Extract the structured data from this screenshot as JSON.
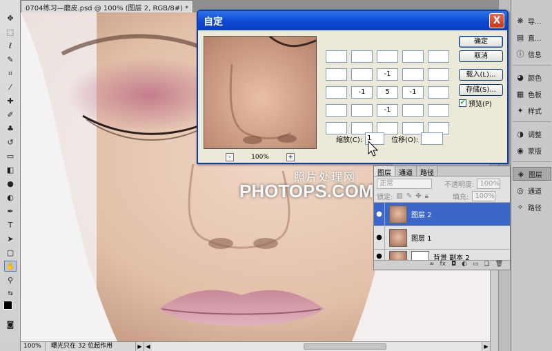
{
  "document": {
    "tab_title": "0704练习—磨皮.psd @ 100% (图层 2, RGB/8#) *",
    "close_glyph": "×"
  },
  "status": {
    "zoom": "100%",
    "message": "曝光只在 32 位起作用"
  },
  "right_dock": {
    "items": [
      {
        "label": "导...",
        "icon": "navigator-icon"
      },
      {
        "label": "直...",
        "icon": "histogram-icon"
      },
      {
        "label": "信息",
        "icon": "info-icon"
      },
      {
        "label": "颜色",
        "icon": "color-icon"
      },
      {
        "label": "色板",
        "icon": "swatches-icon"
      },
      {
        "label": "样式",
        "icon": "styles-icon"
      },
      {
        "label": "调整",
        "icon": "adjustments-icon"
      },
      {
        "label": "蒙版",
        "icon": "masks-icon"
      },
      {
        "label": "图层",
        "icon": "layers-icon"
      },
      {
        "label": "通道",
        "icon": "channels-icon"
      },
      {
        "label": "路径",
        "icon": "paths-icon"
      }
    ]
  },
  "dialog": {
    "title": "自定",
    "close": "X",
    "zoom_minus": "-",
    "zoom_value": "100%",
    "zoom_plus": "+",
    "kernel": [
      [
        "",
        "",
        "",
        "",
        ""
      ],
      [
        "",
        "",
        "-1",
        "",
        ""
      ],
      [
        "",
        "-1",
        "5",
        "-1",
        ""
      ],
      [
        "",
        "",
        "-1",
        "",
        ""
      ],
      [
        "",
        "",
        "",
        "",
        ""
      ]
    ],
    "scale_label": "缩放(C):",
    "scale_value": "1",
    "offset_label": "位移(O):",
    "offset_value": "",
    "buttons": {
      "ok": "确定",
      "cancel": "取消",
      "load": "载入(L)...",
      "save": "存储(S)..."
    },
    "preview_label": "预览(P)",
    "preview_checked": "✔"
  },
  "layers_panel": {
    "tabs": [
      "图层",
      "通道",
      "路径"
    ],
    "blend_mode": "正常",
    "opacity_label": "不透明度:",
    "opacity_value": "100%",
    "lock_label": "锁定:",
    "fill_label": "填充:",
    "fill_value": "100%",
    "layers": [
      {
        "name": "图层 2",
        "selected": true
      },
      {
        "name": "图层 1",
        "selected": false
      },
      {
        "name": "背景 副本 2",
        "selected": false
      }
    ],
    "footer_icons": [
      "link-icon",
      "fx-icon",
      "mask-icon",
      "adjustment-icon",
      "group-icon",
      "new-layer-icon",
      "trash-icon"
    ]
  },
  "watermark": {
    "line1": "照片处理网",
    "line2": "PHOTOPS.COM"
  },
  "colors": {
    "dialog_title": "#0f4bd6",
    "selected_layer": "#3a67c9",
    "skin": "#e7cbb6"
  }
}
